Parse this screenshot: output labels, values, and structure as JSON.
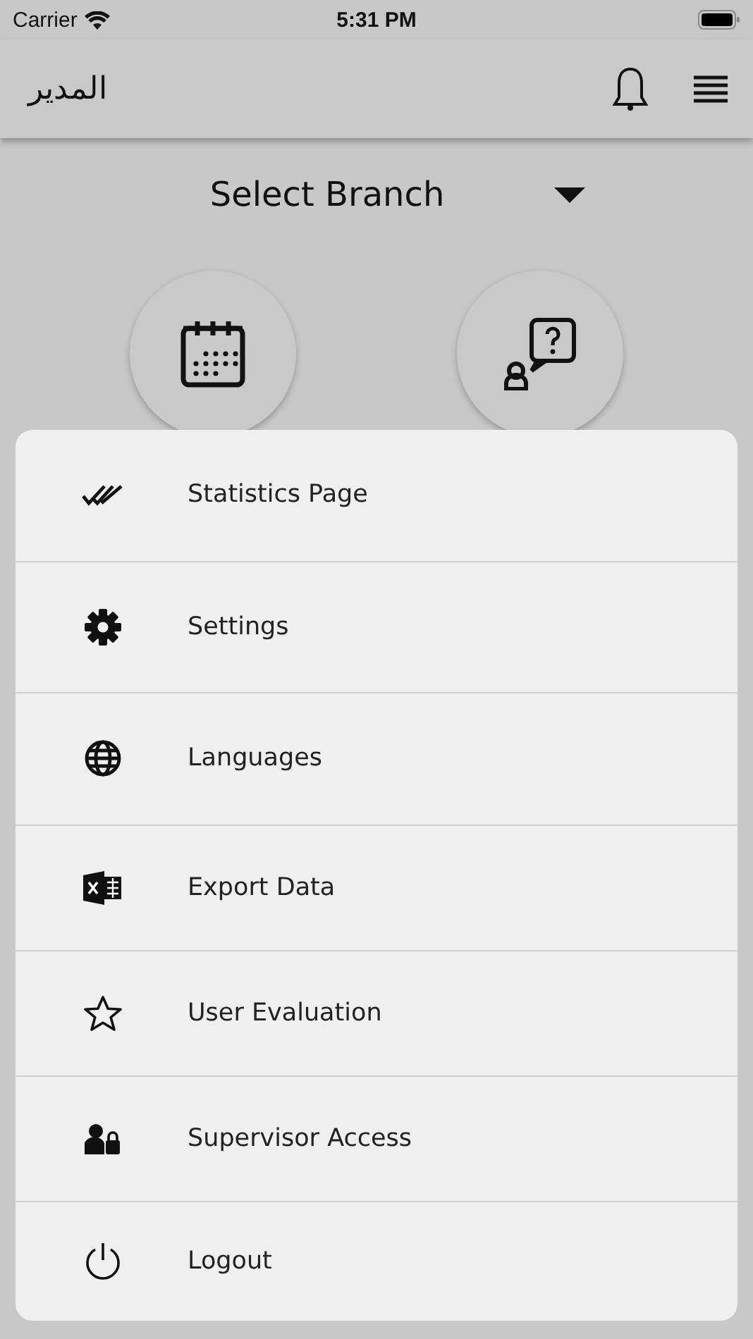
{
  "status_bar": {
    "carrier": "Carrier",
    "time": "5:31 PM"
  },
  "header": {
    "title": "المدير"
  },
  "branch_select": {
    "label": "Select Branch"
  },
  "menu": [
    {
      "kind": "statistics",
      "label": "Statistics Page"
    },
    {
      "kind": "settings",
      "label": "Settings"
    },
    {
      "kind": "languages",
      "label": "Languages"
    },
    {
      "kind": "export",
      "label": "Export Data"
    },
    {
      "kind": "evaluation",
      "label": "User Evaluation"
    },
    {
      "kind": "supervisor",
      "label": "Supervisor Access"
    },
    {
      "kind": "logout",
      "label": "Logout"
    }
  ]
}
